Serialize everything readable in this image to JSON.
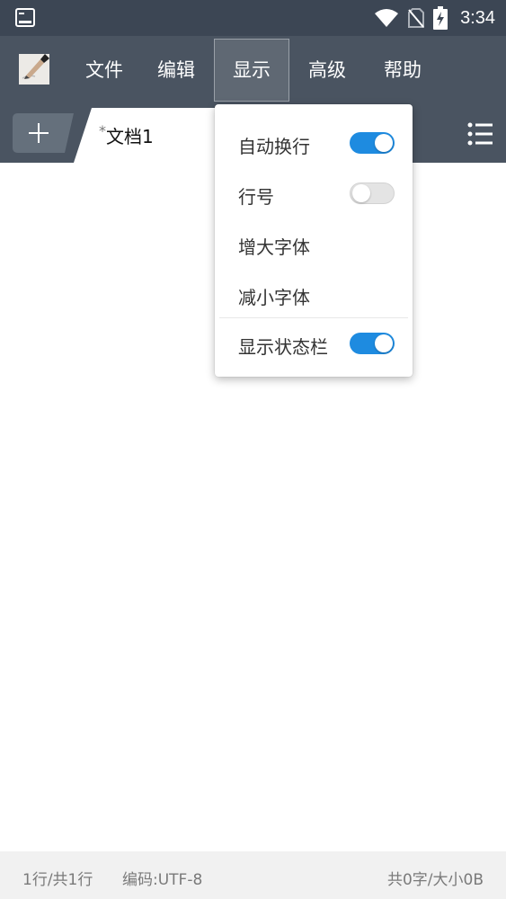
{
  "status_bar": {
    "time": "3:34",
    "icons": [
      "terminal-icon",
      "wifi-icon",
      "no-sim-icon",
      "battery-charging-icon"
    ]
  },
  "menu_bar": {
    "items": [
      {
        "label": "文件"
      },
      {
        "label": "编辑"
      },
      {
        "label": "显示"
      },
      {
        "label": "高级"
      },
      {
        "label": "帮助"
      }
    ],
    "active": "显示"
  },
  "tab_bar": {
    "add_icon": "plus-icon",
    "tab": {
      "modified_marker": "*",
      "title": "文档1"
    },
    "list_icon": "list-icon"
  },
  "display_menu": {
    "items": [
      {
        "label": "自动换行",
        "toggle": true
      },
      {
        "label": "行号",
        "toggle": false
      },
      {
        "label": "增大字体"
      },
      {
        "label": "减小字体"
      },
      {
        "label": "显示状态栏",
        "toggle": true
      }
    ]
  },
  "footer": {
    "lines": "1行/共1行",
    "encoding": "编码:UTF-8",
    "stats": "共0字/大小0B"
  },
  "colors": {
    "status_bar": "#3c4654",
    "toolbar": "#4a5461",
    "toggle_on": "#1e8be0",
    "footer_bg": "#f1f1f1"
  }
}
